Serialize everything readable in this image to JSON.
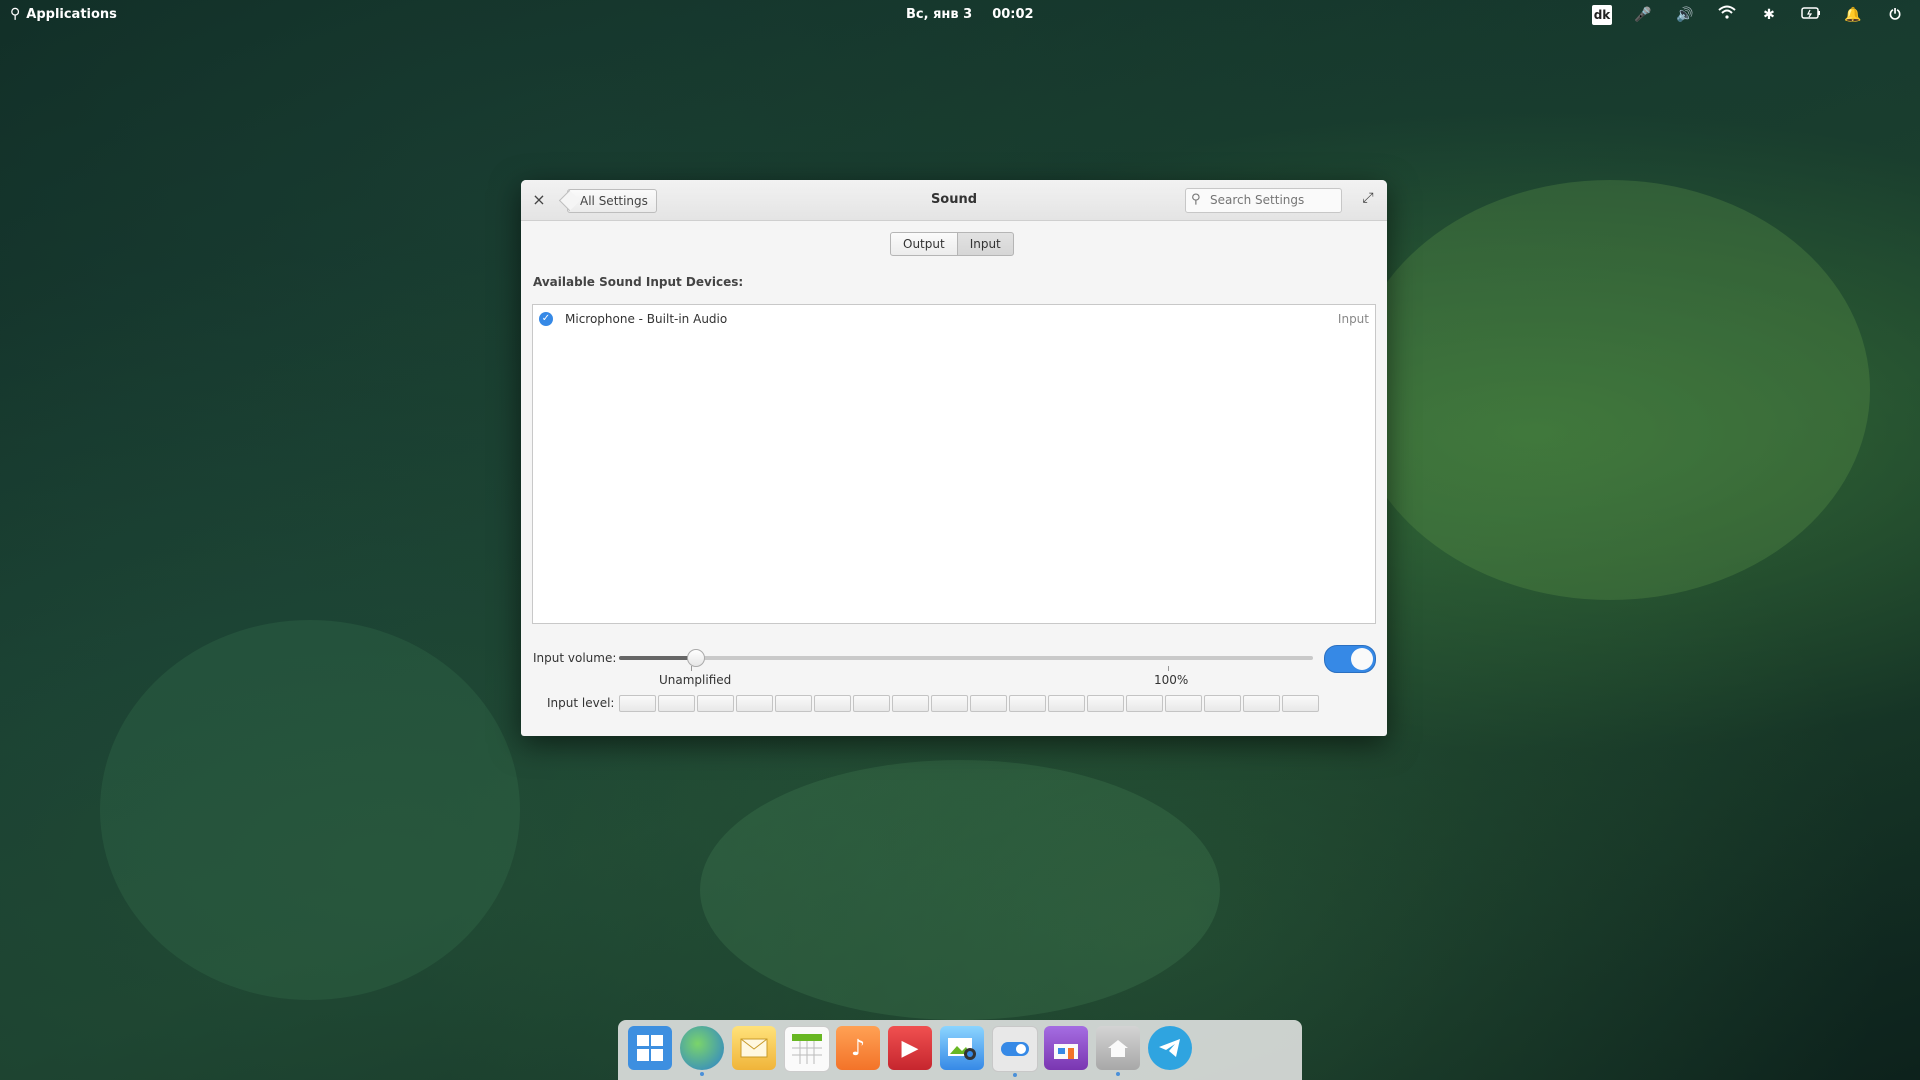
{
  "panel": {
    "applications_label": "Applications",
    "date": "Вс, янв  3",
    "time": "00:02",
    "keyboard_layout": "dk"
  },
  "window": {
    "close_label": "×",
    "back_label": "All Settings",
    "title": "Sound",
    "search_placeholder": "Search Settings",
    "tabs": [
      "Output",
      "Input"
    ],
    "selected_tab": "Input",
    "devices_heading": "Available Sound Input Devices:",
    "devices": [
      {
        "name": "Microphone - Built-in Audio",
        "type": "Input",
        "selected": true
      }
    ],
    "input_volume_label": "Input volume:",
    "input_volume_fraction": 0.11,
    "mark_unamplified": "Unamplified",
    "mark_100": "100%",
    "input_enabled": true,
    "input_level_label": "Input level:",
    "input_level_segments": 18
  },
  "dock": {
    "items": [
      "multitasking-view",
      "web-browser",
      "mail",
      "calendar",
      "music",
      "videos",
      "photos",
      "system-settings",
      "appcenter",
      "files",
      "telegram"
    ]
  },
  "colors": {
    "accent": "#3689e6"
  }
}
